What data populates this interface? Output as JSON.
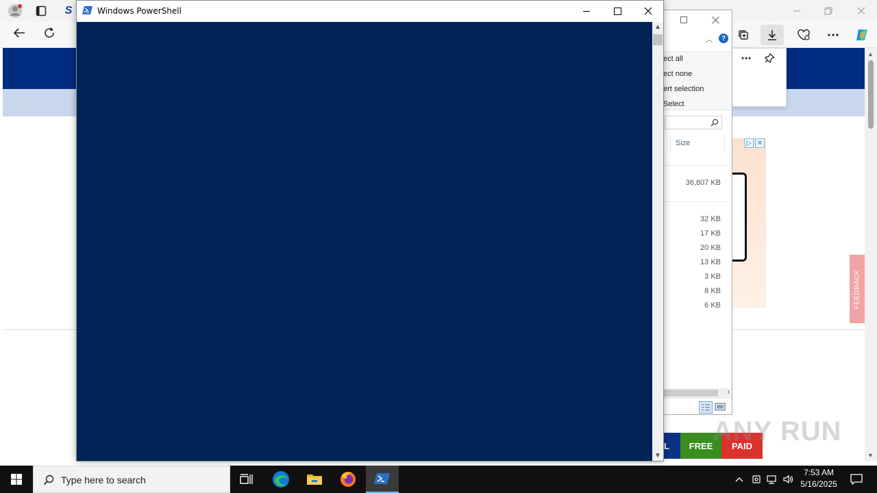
{
  "powershell": {
    "title": "Windows PowerShell"
  },
  "explorer": {
    "ribbon": {
      "select_all": "ect all",
      "select_none": "ect none",
      "invert_selection": "ert selection",
      "select_group": "Select"
    },
    "help_label": "?",
    "columns": {
      "size": "Size"
    },
    "sizes": [
      "36,807 KB",
      "32 KB",
      "17 KB",
      "20 KB",
      "13 KB",
      "3 KB",
      "8 KB",
      "6 KB"
    ]
  },
  "browser": {
    "feedback_label": "FEEDBACK",
    "site_letter": "S",
    "buttons": {
      "free": "FREE",
      "paid": "PAID",
      "partial": "L"
    },
    "watermark": "ANY RUN"
  },
  "taskbar": {
    "search_placeholder": "Type here to search",
    "time": "7:53 AM",
    "date": "5/16/2025"
  },
  "colors": {
    "console_background": "#012456",
    "taskbar": "#101010",
    "page_banner": "#002b7f"
  },
  "icons": [
    "profile-icon",
    "tabs-icon",
    "back-icon",
    "reload-icon",
    "collections-icon",
    "downloads-icon",
    "extensions-icon",
    "more-icon",
    "copilot-icon",
    "pin-icon",
    "powershell-icon",
    "windows-start-icon",
    "search-icon",
    "task-view-icon",
    "edge-icon",
    "file-explorer-icon",
    "firefox-icon",
    "chevron-up-icon",
    "network-icon",
    "volume-icon",
    "notification-icon"
  ]
}
